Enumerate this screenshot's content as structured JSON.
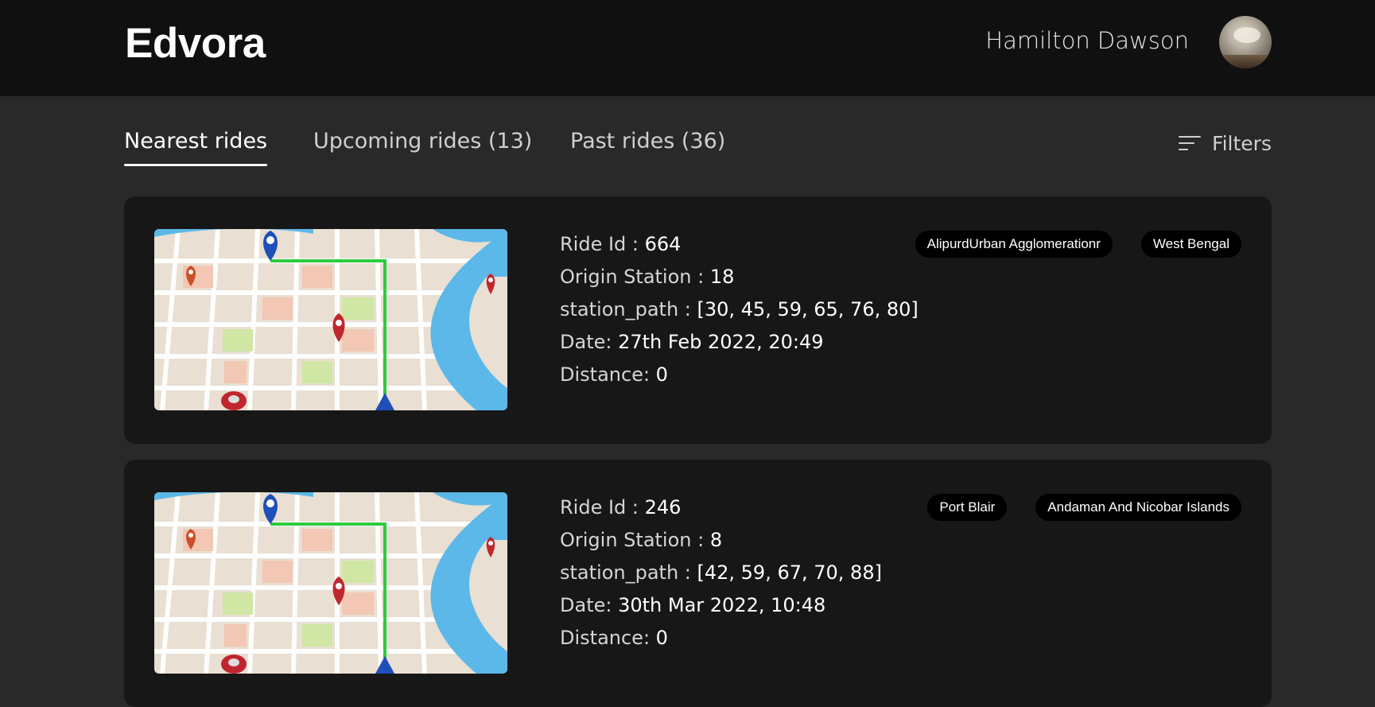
{
  "header": {
    "brand": "Edvora",
    "user_name": "Hamilton Dawson"
  },
  "tabs": [
    {
      "label": "Nearest rides",
      "active": true
    },
    {
      "label": "Upcoming rides (13)",
      "active": false
    },
    {
      "label": "Past rides (36)",
      "active": false
    }
  ],
  "filters": {
    "label": "Filters",
    "icon": "filter-lines-icon"
  },
  "labels": {
    "ride_id": "Ride Id : ",
    "origin": "Origin Station : ",
    "path": "station_path : ",
    "date": "Date: ",
    "distance": "Distance: "
  },
  "rides": [
    {
      "ride_id": "664",
      "origin_station": "18",
      "station_path": "[30, 45, 59, 65, 76, 80]",
      "date": "27th Feb 2022, 20:49",
      "distance": "0",
      "city": "AlipurdUrban Agglomerationr",
      "state": "West Bengal"
    },
    {
      "ride_id": "246",
      "origin_station": "8",
      "station_path": "[42, 59, 67, 70, 88]",
      "date": "30th Mar 2022, 10:48",
      "distance": "0",
      "city": "Port Blair",
      "state": "Andaman And Nicobar Islands"
    }
  ],
  "colors": {
    "page_bg": "#292929",
    "header_bg": "#101010",
    "card_bg": "#171717",
    "badge_bg": "#000000",
    "route_green": "#2ecc40",
    "river_blue": "#5bb8e8"
  }
}
